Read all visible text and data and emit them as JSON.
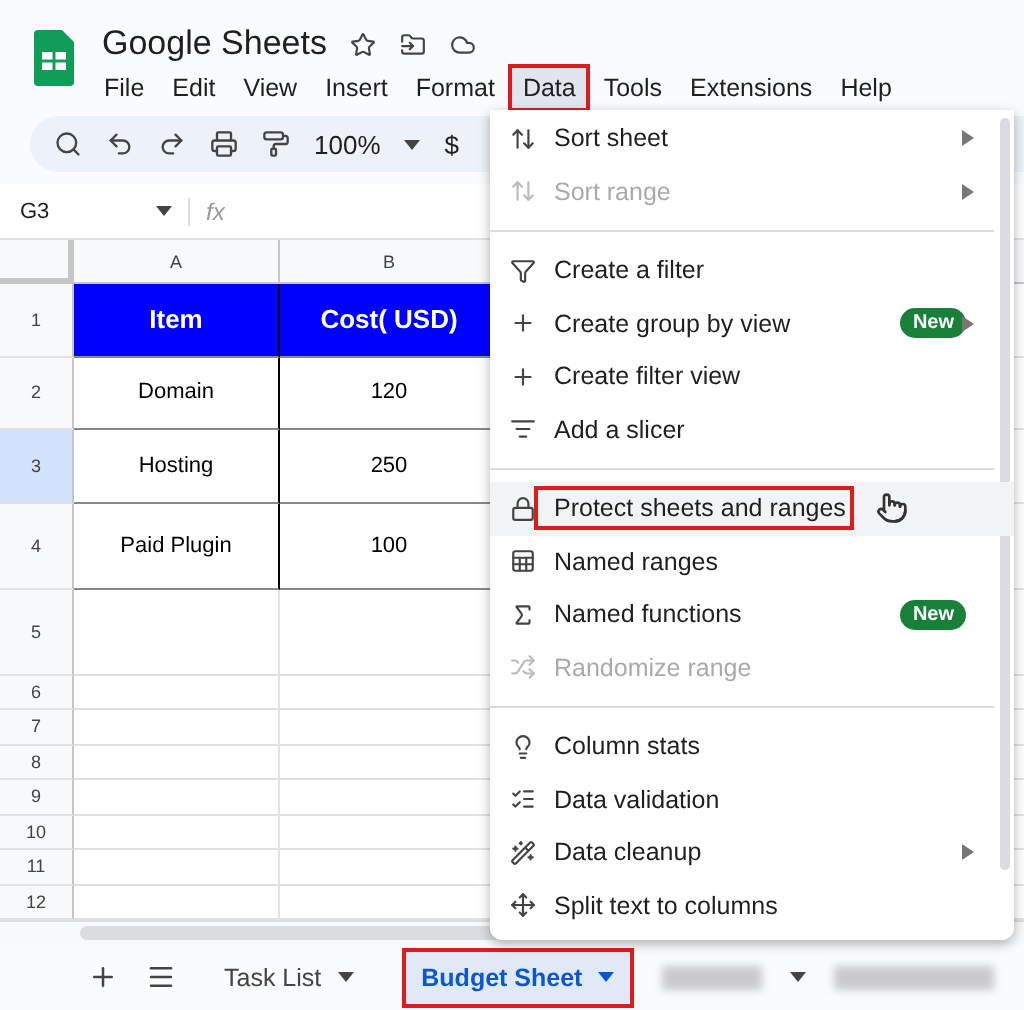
{
  "app": {
    "title": "Google Sheets"
  },
  "menu_bar": [
    {
      "label": "File",
      "selected": false
    },
    {
      "label": "Edit",
      "selected": false
    },
    {
      "label": "View",
      "selected": false
    },
    {
      "label": "Insert",
      "selected": false
    },
    {
      "label": "Format",
      "selected": false
    },
    {
      "label": "Data",
      "selected": true
    },
    {
      "label": "Tools",
      "selected": false
    },
    {
      "label": "Extensions",
      "selected": false
    },
    {
      "label": "Help",
      "selected": false
    }
  ],
  "toolbar": {
    "zoom": "100%",
    "currency": "$"
  },
  "formula_bar": {
    "cell_ref": "G3",
    "fx": "fx"
  },
  "columns": [
    {
      "label": "A"
    },
    {
      "label": "B"
    }
  ],
  "rows": [
    {
      "number": "1",
      "selected": false,
      "cells": [
        {
          "text": "Item",
          "kind": "header"
        },
        {
          "text": "Cost( USD)",
          "kind": "header"
        }
      ]
    },
    {
      "number": "2",
      "selected": false,
      "cells": [
        {
          "text": "Domain",
          "kind": "body"
        },
        {
          "text": "120",
          "kind": "body"
        }
      ]
    },
    {
      "number": "3",
      "selected": true,
      "cells": [
        {
          "text": "Hosting",
          "kind": "body"
        },
        {
          "text": "250",
          "kind": "body"
        }
      ]
    },
    {
      "number": "4",
      "selected": false,
      "cells": [
        {
          "text": "Paid Plugin",
          "kind": "body"
        },
        {
          "text": "100",
          "kind": "body"
        }
      ]
    },
    {
      "number": "5",
      "selected": false
    },
    {
      "number": "6",
      "selected": false
    },
    {
      "number": "7",
      "selected": false
    },
    {
      "number": "8",
      "selected": false
    },
    {
      "number": "9",
      "selected": false
    },
    {
      "number": "10",
      "selected": false
    },
    {
      "number": "11",
      "selected": false
    },
    {
      "number": "12",
      "selected": false
    }
  ],
  "data_menu": [
    {
      "kind": "item",
      "label": "Sort sheet",
      "disabled": false,
      "submenu": true,
      "highlighted": false
    },
    {
      "kind": "item",
      "label": "Sort range",
      "disabled": true,
      "submenu": true,
      "highlighted": false
    },
    {
      "kind": "divider"
    },
    {
      "kind": "item",
      "label": "Create a filter",
      "disabled": false,
      "submenu": false,
      "highlighted": false
    },
    {
      "kind": "item",
      "label": "Create group by view",
      "disabled": false,
      "submenu": true,
      "badge": "New",
      "highlighted": false
    },
    {
      "kind": "item",
      "label": "Create filter view",
      "disabled": false,
      "submenu": false,
      "highlighted": false
    },
    {
      "kind": "item",
      "label": "Add a slicer",
      "disabled": false,
      "submenu": false,
      "highlighted": false
    },
    {
      "kind": "divider"
    },
    {
      "kind": "item",
      "label": "Protect sheets and ranges",
      "disabled": false,
      "submenu": false,
      "highlighted": true
    },
    {
      "kind": "item",
      "label": "Named ranges",
      "disabled": false,
      "submenu": false,
      "highlighted": false
    },
    {
      "kind": "item",
      "label": "Named functions",
      "disabled": false,
      "submenu": false,
      "badge": "New",
      "highlighted": false
    },
    {
      "kind": "item",
      "label": "Randomize range",
      "disabled": true,
      "submenu": false,
      "highlighted": false
    },
    {
      "kind": "divider"
    },
    {
      "kind": "item",
      "label": "Column stats",
      "disabled": false,
      "submenu": false,
      "highlighted": false
    },
    {
      "kind": "item",
      "label": "Data validation",
      "disabled": false,
      "submenu": false,
      "highlighted": false
    },
    {
      "kind": "item",
      "label": "Data cleanup",
      "disabled": false,
      "submenu": true,
      "highlighted": false
    },
    {
      "kind": "item",
      "label": "Split text to columns",
      "disabled": false,
      "submenu": false,
      "highlighted": false
    }
  ],
  "sheet_tabs": [
    {
      "label": "Task List",
      "selected": false
    },
    {
      "label": "Budget Sheet",
      "selected": true
    }
  ]
}
